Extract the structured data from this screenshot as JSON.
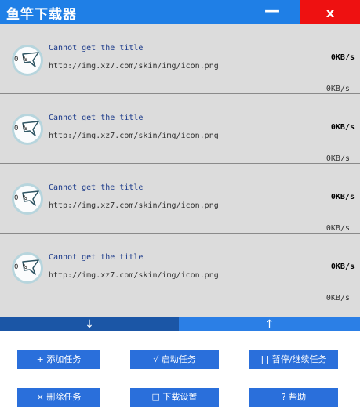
{
  "app_title": "鱼竿下载器",
  "window": {
    "minimize_label": "—",
    "close_label": "x"
  },
  "downloads": [
    {
      "percent": "0 %",
      "title": "Cannot get the title",
      "url": "http://img.xz7.com/skin/img/icon.png",
      "speed": "0KB/s",
      "speed_secondary": "0KB/s"
    },
    {
      "percent": "0 %",
      "title": "Cannot get the title",
      "url": "http://img.xz7.com/skin/img/icon.png",
      "speed": "0KB/s",
      "speed_secondary": "0KB/s"
    },
    {
      "percent": "0 %",
      "title": "Cannot get the title",
      "url": "http://img.xz7.com/skin/img/icon.png",
      "speed": "0KB/s",
      "speed_secondary": "0KB/s"
    },
    {
      "percent": "0 %",
      "title": "Cannot get the title",
      "url": "http://img.xz7.com/skin/img/icon.png",
      "speed": "0KB/s",
      "speed_secondary": "0KB/s"
    }
  ],
  "scroll": {
    "down_label": "↓",
    "up_label": "↑"
  },
  "buttons": {
    "add_task": "+ 添加任务",
    "start_task": "√ 启动任务",
    "pause_resume": "| | 暂停/继续任务",
    "delete_task": "× 删除任务",
    "download_settings": "□ 下载设置",
    "help": "? 帮助"
  },
  "colors": {
    "titlebar": "#1f7fe6",
    "close": "#ee1111",
    "button": "#2a6fdb",
    "scroll_down": "#1b56a6",
    "scroll_up": "#2b7fe6",
    "list_bg": "#dcdcdc"
  }
}
